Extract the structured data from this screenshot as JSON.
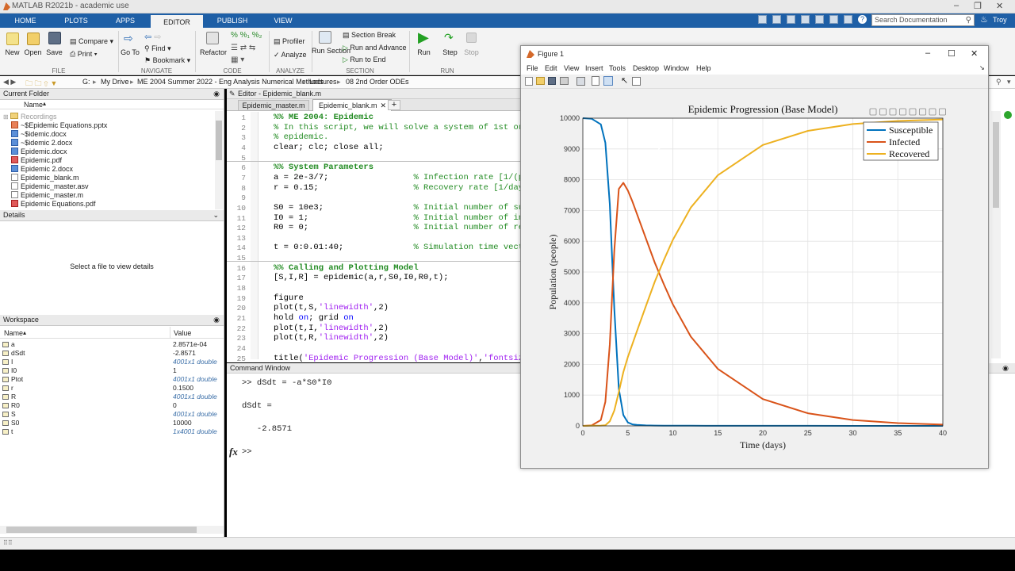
{
  "window": {
    "title": "MATLAB R2021b - academic use",
    "user": "Troy"
  },
  "tabs": [
    "HOME",
    "PLOTS",
    "APPS",
    "EDITOR",
    "PUBLISH",
    "VIEW"
  ],
  "search": {
    "placeholder": "Search Documentation"
  },
  "toolstrip": {
    "new": "New",
    "open": "Open",
    "save": "Save",
    "compare": "Compare",
    "print": "Print",
    "goto": "Go To",
    "find": "Find",
    "bookmark": "Bookmark",
    "refactor": "Refactor",
    "profiler": "Profiler",
    "analyze": "Analyze",
    "run_section": "Run Section",
    "section_break": "Section Break",
    "run_and_advance": "Run and Advance",
    "run_to_end": "Run to End",
    "run": "Run",
    "step": "Step",
    "stop": "Stop",
    "groups": [
      "FILE",
      "NAVIGATE",
      "CODE",
      "ANALYZE",
      "SECTION",
      "RUN"
    ]
  },
  "address": {
    "parts": [
      "G:",
      "My Drive",
      "ME 2004 Summer 2022 - Eng Analysis Numerical Methods",
      "Lectures",
      "08 2nd Order ODEs"
    ]
  },
  "current_folder": {
    "title": "Current Folder",
    "col_name": "Name",
    "items": [
      "Recordings",
      "~$Epidemic Equations.pptx",
      "~$idemic.docx",
      "~$idemic 2.docx",
      "Epidemic.docx",
      "Epidemic.pdf",
      "Epidemic 2.docx",
      "Epidemic_blank.m",
      "Epidemic_master.asv",
      "Epidemic_master.m",
      "Epidemic Equations.pdf"
    ]
  },
  "details": {
    "title": "Details",
    "placeholder": "Select a file to view details"
  },
  "workspace": {
    "title": "Workspace",
    "col_name": "Name",
    "col_value": "Value",
    "rows": [
      {
        "name": "a",
        "value": "2.8571e-04",
        "italic": false
      },
      {
        "name": "dSdt",
        "value": "-2.8571",
        "italic": false
      },
      {
        "name": "I",
        "value": "4001x1 double",
        "italic": true
      },
      {
        "name": "I0",
        "value": "1",
        "italic": false
      },
      {
        "name": "Ptot",
        "value": "4001x1 double",
        "italic": true
      },
      {
        "name": "r",
        "value": "0.1500",
        "italic": false
      },
      {
        "name": "R",
        "value": "4001x1 double",
        "italic": true
      },
      {
        "name": "R0",
        "value": "0",
        "italic": false
      },
      {
        "name": "S",
        "value": "4001x1 double",
        "italic": true
      },
      {
        "name": "S0",
        "value": "10000",
        "italic": false
      },
      {
        "name": "t",
        "value": "1x4001 double",
        "italic": true
      }
    ]
  },
  "editor": {
    "title": "Editor - Epidemic_blank.m",
    "tabs": [
      "Epidemic_master.m",
      "Epidemic_blank.m"
    ],
    "lines": [
      {
        "n": "1",
        "html": "<span class=\"cb\">%% ME 2004: Epidemic</span>"
      },
      {
        "n": "2",
        "html": "<span class=\"c\">% In this script, we will solve a system of 1st order</span>"
      },
      {
        "n": "3",
        "html": "<span class=\"c\">% epidemic.</span>"
      },
      {
        "n": "4",
        "html": "clear; clc; close all;"
      },
      {
        "n": "5",
        "html": ""
      },
      {
        "n": "6",
        "html": "<span class=\"cb\">%% System Parameters</span>"
      },
      {
        "n": "7",
        "html": "a = 2e-3/7;                 <span class=\"c\">% Infection rate [1/(pers</span>"
      },
      {
        "n": "8",
        "html": "r = 0.15;                   <span class=\"c\">% Recovery rate [1/day]</span>"
      },
      {
        "n": "9",
        "html": ""
      },
      {
        "n": "10",
        "html": "S0 = 10e3;                  <span class=\"c\">% Initial number of susce</span>"
      },
      {
        "n": "11",
        "html": "I0 = 1;                     <span class=\"c\">% Initial number of infec</span>"
      },
      {
        "n": "12",
        "html": "R0 = 0;                     <span class=\"c\">% Initial number of recov</span>"
      },
      {
        "n": "13",
        "html": ""
      },
      {
        "n": "14",
        "html": "t = 0:0.01:40;              <span class=\"c\">% Simulation time vector</span>"
      },
      {
        "n": "15",
        "html": ""
      },
      {
        "n": "16",
        "html": "<span class=\"cb\">%% Calling and Plotting Model</span>"
      },
      {
        "n": "17",
        "html": "[S,I,R] = epidemic(a,r,S0,I0,R0,t);"
      },
      {
        "n": "18",
        "html": ""
      },
      {
        "n": "19",
        "html": "figure"
      },
      {
        "n": "20",
        "html": "plot(t,S,<span class=\"s\">'linewidth'</span>,2)"
      },
      {
        "n": "21",
        "html": "hold <span class=\"k\">on</span>; grid <span class=\"k\">on</span>"
      },
      {
        "n": "22",
        "html": "plot(t,I,<span class=\"s\">'linewidth'</span>,2)"
      },
      {
        "n": "23",
        "html": "plot(t,R,<span class=\"s\">'linewidth'</span>,2)"
      },
      {
        "n": "24",
        "html": ""
      },
      {
        "n": "25",
        "html": "title(<span class=\"s\">'Epidemic Progression (Base Model)'</span>,<span class=\"s\">'fontsize'</span>"
      }
    ]
  },
  "command_window": {
    "title": "Command Window",
    "lines": [
      ">> dSdt = -a*S0*I0",
      "",
      "dSdt =",
      "",
      "   -2.8571",
      ""
    ],
    "prompt": ">>"
  },
  "figure": {
    "title": "Figure 1",
    "menus": [
      "File",
      "Edit",
      "View",
      "Insert",
      "Tools",
      "Desktop",
      "Window",
      "Help"
    ]
  },
  "chart_data": {
    "type": "line",
    "title": "Epidemic Progression (Base Model)",
    "xlabel": "Time (days)",
    "ylabel": "Population (people)",
    "xlim": [
      0,
      40
    ],
    "ylim": [
      0,
      10000
    ],
    "xticks": [
      "0",
      "5",
      "10",
      "15",
      "20",
      "25",
      "30",
      "35",
      "40"
    ],
    "yticks": [
      "0",
      "1000",
      "2000",
      "3000",
      "4000",
      "5000",
      "6000",
      "7000",
      "8000",
      "9000",
      "10000"
    ],
    "grid": true,
    "legend_position": "top-right",
    "x": [
      0,
      1,
      2,
      2.5,
      3,
      3.5,
      4,
      4.5,
      5,
      5.5,
      6,
      7,
      8,
      9,
      10,
      12,
      15,
      20,
      25,
      30,
      35,
      40
    ],
    "series": [
      {
        "name": "Susceptible",
        "color": "#0072bd",
        "values": [
          10000,
          9980,
          9800,
          9200,
          7200,
          3800,
          1200,
          350,
          110,
          50,
          30,
          15,
          10,
          8,
          6,
          4,
          3,
          2,
          2,
          1,
          1,
          1
        ]
      },
      {
        "name": "Infected",
        "color": "#d95319",
        "values": [
          1,
          15,
          190,
          780,
          2650,
          5700,
          7700,
          7900,
          7650,
          7300,
          6900,
          6100,
          5300,
          4600,
          3950,
          2900,
          1850,
          870,
          410,
          190,
          90,
          40
        ]
      },
      {
        "name": "Recovered",
        "color": "#edb120",
        "values": [
          0,
          5,
          10,
          20,
          150,
          500,
          1100,
          1750,
          2240,
          2650,
          3070,
          3885,
          4690,
          5390,
          6044,
          7096,
          8147,
          9128,
          9588,
          9809,
          9909,
          9959
        ]
      }
    ]
  }
}
